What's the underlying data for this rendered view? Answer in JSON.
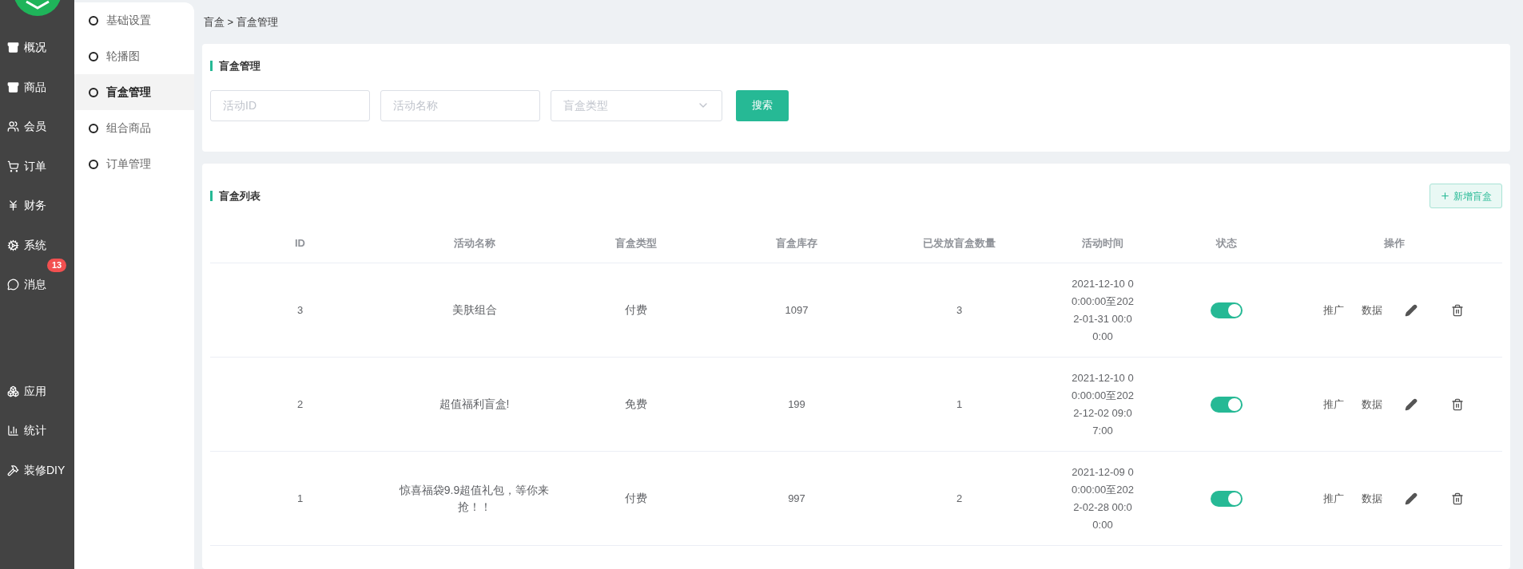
{
  "nav_upper": [
    {
      "label": "概况"
    },
    {
      "label": "商品"
    },
    {
      "label": "会员"
    },
    {
      "label": "订单"
    },
    {
      "label": "财务"
    },
    {
      "label": "系统"
    },
    {
      "label": "消息",
      "badge": "13"
    }
  ],
  "nav_lower": [
    {
      "label": "应用"
    },
    {
      "label": "统计"
    },
    {
      "label": "装修DIY"
    }
  ],
  "submenu": [
    {
      "label": "基础设置",
      "selected": false
    },
    {
      "label": "轮播图",
      "selected": false
    },
    {
      "label": "盲盒管理",
      "selected": true
    },
    {
      "label": "组合商品",
      "selected": false
    },
    {
      "label": "订单管理",
      "selected": false
    }
  ],
  "breadcrumb": "盲盒 > 盲盒管理",
  "search_card": {
    "title": "盲盒管理",
    "fields": [
      {
        "kind": "input",
        "placeholder": "活动ID"
      },
      {
        "kind": "input",
        "placeholder": "活动名称"
      },
      {
        "kind": "select",
        "placeholder": "盲盒类型"
      }
    ],
    "button": "搜索"
  },
  "list_card": {
    "title": "盲盒列表",
    "add_button": "新增盲盒",
    "columns": [
      "ID",
      "活动名称",
      "盲盒类型",
      "盲盒库存",
      "已发放盲盒数量",
      "活动时间",
      "状态",
      "操作"
    ],
    "rows": [
      {
        "id": "3",
        "name": "美肤组合",
        "type": "付费",
        "stock": "1097",
        "issued": "3",
        "time": "2021-12-10 00:00:00至2022-01-31 00:00:00",
        "on": true,
        "actions": [
          "推广",
          "数据"
        ]
      },
      {
        "id": "2",
        "name": "超值福利盲盒!",
        "type": "免费",
        "stock": "199",
        "issued": "1",
        "time": "2021-12-10 00:00:00至2022-12-02 09:07:00",
        "on": true,
        "actions": [
          "推广",
          "数据"
        ]
      },
      {
        "id": "1",
        "name": "惊喜福袋9.9超值礼包，等你来抢！！",
        "type": "付费",
        "stock": "997",
        "issued": "2",
        "time": "2021-12-09 00:00:00至2022-02-28 00:00:00",
        "on": true,
        "actions": [
          "推广",
          "数据"
        ]
      }
    ]
  }
}
